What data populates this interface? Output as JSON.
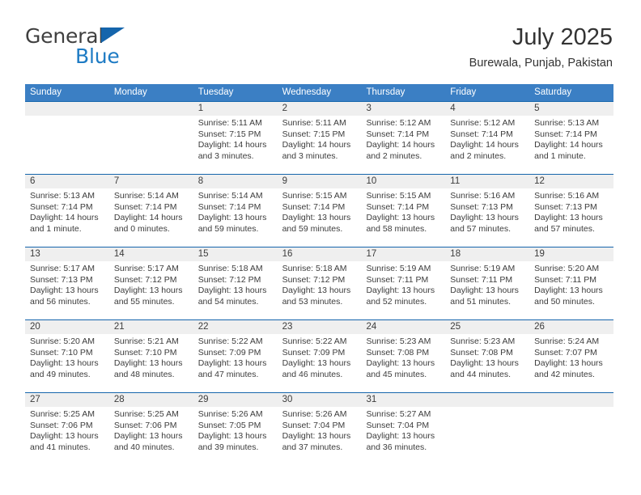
{
  "logo": {
    "primary": "General",
    "secondary": "Blue",
    "triangle_color": "#1565ac"
  },
  "header": {
    "title": "July 2025",
    "subtitle": "Burewala, Punjab, Pakistan"
  },
  "theme": {
    "header_blue": "#3b7fc4",
    "divider_blue": "#1565ac",
    "daynum_band": "#efefef",
    "text": "#3c3c3c"
  },
  "weekdays": [
    "Sunday",
    "Monday",
    "Tuesday",
    "Wednesday",
    "Thursday",
    "Friday",
    "Saturday"
  ],
  "weeks": [
    [
      {
        "day": "",
        "sunrise": "",
        "sunset": "",
        "daylight": ""
      },
      {
        "day": "",
        "sunrise": "",
        "sunset": "",
        "daylight": ""
      },
      {
        "day": "1",
        "sunrise": "Sunrise: 5:11 AM",
        "sunset": "Sunset: 7:15 PM",
        "daylight": "Daylight: 14 hours and 3 minutes."
      },
      {
        "day": "2",
        "sunrise": "Sunrise: 5:11 AM",
        "sunset": "Sunset: 7:15 PM",
        "daylight": "Daylight: 14 hours and 3 minutes."
      },
      {
        "day": "3",
        "sunrise": "Sunrise: 5:12 AM",
        "sunset": "Sunset: 7:14 PM",
        "daylight": "Daylight: 14 hours and 2 minutes."
      },
      {
        "day": "4",
        "sunrise": "Sunrise: 5:12 AM",
        "sunset": "Sunset: 7:14 PM",
        "daylight": "Daylight: 14 hours and 2 minutes."
      },
      {
        "day": "5",
        "sunrise": "Sunrise: 5:13 AM",
        "sunset": "Sunset: 7:14 PM",
        "daylight": "Daylight: 14 hours and 1 minute."
      }
    ],
    [
      {
        "day": "6",
        "sunrise": "Sunrise: 5:13 AM",
        "sunset": "Sunset: 7:14 PM",
        "daylight": "Daylight: 14 hours and 1 minute."
      },
      {
        "day": "7",
        "sunrise": "Sunrise: 5:14 AM",
        "sunset": "Sunset: 7:14 PM",
        "daylight": "Daylight: 14 hours and 0 minutes."
      },
      {
        "day": "8",
        "sunrise": "Sunrise: 5:14 AM",
        "sunset": "Sunset: 7:14 PM",
        "daylight": "Daylight: 13 hours and 59 minutes."
      },
      {
        "day": "9",
        "sunrise": "Sunrise: 5:15 AM",
        "sunset": "Sunset: 7:14 PM",
        "daylight": "Daylight: 13 hours and 59 minutes."
      },
      {
        "day": "10",
        "sunrise": "Sunrise: 5:15 AM",
        "sunset": "Sunset: 7:14 PM",
        "daylight": "Daylight: 13 hours and 58 minutes."
      },
      {
        "day": "11",
        "sunrise": "Sunrise: 5:16 AM",
        "sunset": "Sunset: 7:13 PM",
        "daylight": "Daylight: 13 hours and 57 minutes."
      },
      {
        "day": "12",
        "sunrise": "Sunrise: 5:16 AM",
        "sunset": "Sunset: 7:13 PM",
        "daylight": "Daylight: 13 hours and 57 minutes."
      }
    ],
    [
      {
        "day": "13",
        "sunrise": "Sunrise: 5:17 AM",
        "sunset": "Sunset: 7:13 PM",
        "daylight": "Daylight: 13 hours and 56 minutes."
      },
      {
        "day": "14",
        "sunrise": "Sunrise: 5:17 AM",
        "sunset": "Sunset: 7:12 PM",
        "daylight": "Daylight: 13 hours and 55 minutes."
      },
      {
        "day": "15",
        "sunrise": "Sunrise: 5:18 AM",
        "sunset": "Sunset: 7:12 PM",
        "daylight": "Daylight: 13 hours and 54 minutes."
      },
      {
        "day": "16",
        "sunrise": "Sunrise: 5:18 AM",
        "sunset": "Sunset: 7:12 PM",
        "daylight": "Daylight: 13 hours and 53 minutes."
      },
      {
        "day": "17",
        "sunrise": "Sunrise: 5:19 AM",
        "sunset": "Sunset: 7:11 PM",
        "daylight": "Daylight: 13 hours and 52 minutes."
      },
      {
        "day": "18",
        "sunrise": "Sunrise: 5:19 AM",
        "sunset": "Sunset: 7:11 PM",
        "daylight": "Daylight: 13 hours and 51 minutes."
      },
      {
        "day": "19",
        "sunrise": "Sunrise: 5:20 AM",
        "sunset": "Sunset: 7:11 PM",
        "daylight": "Daylight: 13 hours and 50 minutes."
      }
    ],
    [
      {
        "day": "20",
        "sunrise": "Sunrise: 5:20 AM",
        "sunset": "Sunset: 7:10 PM",
        "daylight": "Daylight: 13 hours and 49 minutes."
      },
      {
        "day": "21",
        "sunrise": "Sunrise: 5:21 AM",
        "sunset": "Sunset: 7:10 PM",
        "daylight": "Daylight: 13 hours and 48 minutes."
      },
      {
        "day": "22",
        "sunrise": "Sunrise: 5:22 AM",
        "sunset": "Sunset: 7:09 PM",
        "daylight": "Daylight: 13 hours and 47 minutes."
      },
      {
        "day": "23",
        "sunrise": "Sunrise: 5:22 AM",
        "sunset": "Sunset: 7:09 PM",
        "daylight": "Daylight: 13 hours and 46 minutes."
      },
      {
        "day": "24",
        "sunrise": "Sunrise: 5:23 AM",
        "sunset": "Sunset: 7:08 PM",
        "daylight": "Daylight: 13 hours and 45 minutes."
      },
      {
        "day": "25",
        "sunrise": "Sunrise: 5:23 AM",
        "sunset": "Sunset: 7:08 PM",
        "daylight": "Daylight: 13 hours and 44 minutes."
      },
      {
        "day": "26",
        "sunrise": "Sunrise: 5:24 AM",
        "sunset": "Sunset: 7:07 PM",
        "daylight": "Daylight: 13 hours and 42 minutes."
      }
    ],
    [
      {
        "day": "27",
        "sunrise": "Sunrise: 5:25 AM",
        "sunset": "Sunset: 7:06 PM",
        "daylight": "Daylight: 13 hours and 41 minutes."
      },
      {
        "day": "28",
        "sunrise": "Sunrise: 5:25 AM",
        "sunset": "Sunset: 7:06 PM",
        "daylight": "Daylight: 13 hours and 40 minutes."
      },
      {
        "day": "29",
        "sunrise": "Sunrise: 5:26 AM",
        "sunset": "Sunset: 7:05 PM",
        "daylight": "Daylight: 13 hours and 39 minutes."
      },
      {
        "day": "30",
        "sunrise": "Sunrise: 5:26 AM",
        "sunset": "Sunset: 7:04 PM",
        "daylight": "Daylight: 13 hours and 37 minutes."
      },
      {
        "day": "31",
        "sunrise": "Sunrise: 5:27 AM",
        "sunset": "Sunset: 7:04 PM",
        "daylight": "Daylight: 13 hours and 36 minutes."
      },
      {
        "day": "",
        "sunrise": "",
        "sunset": "",
        "daylight": ""
      },
      {
        "day": "",
        "sunrise": "",
        "sunset": "",
        "daylight": ""
      }
    ]
  ]
}
